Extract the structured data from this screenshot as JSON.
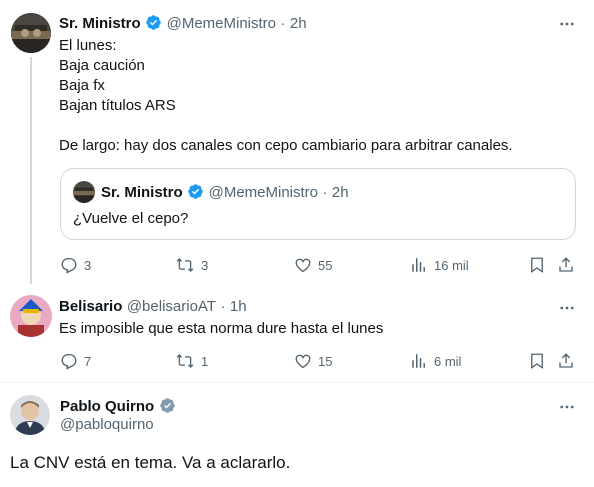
{
  "tweets": [
    {
      "author": "Sr. Ministro",
      "handle": "@MemeMinistro",
      "time": "2h",
      "lines": [
        "El lunes:",
        "Baja caución",
        "Baja fx",
        "Bajan títulos ARS",
        "",
        "De largo: hay dos canales con cepo cambiario para arbitrar canales."
      ],
      "verified": true,
      "quote": {
        "author": "Sr. Ministro",
        "handle": "@MemeMinistro",
        "time": "2h",
        "text": "¿Vuelve el cepo?"
      },
      "stats": {
        "replies": "3",
        "retweets": "3",
        "likes": "55",
        "views": "16 mil"
      }
    },
    {
      "author": "Belisario",
      "handle": "@belisarioAT",
      "time": "1h",
      "text": "Es imposible que esta norma dure hasta el lunes",
      "verified": false,
      "stats": {
        "replies": "7",
        "retweets": "1",
        "likes": "15",
        "views": "6 mil"
      }
    },
    {
      "author": "Pablo Quirno",
      "handle": "@pabloquirno",
      "text": "La CNV está en tema. Va a aclararlo.",
      "verified": true
    }
  ],
  "separator": "·",
  "colors": {
    "verified_blue": "#1d9bf0",
    "verified_gray": "#829aab",
    "muted": "#536471",
    "text": "#0f1419"
  },
  "icons": [
    "verified-badge-icon",
    "more-icon",
    "reply-icon",
    "retweet-icon",
    "like-icon",
    "views-icon",
    "bookmark-icon",
    "share-icon"
  ]
}
